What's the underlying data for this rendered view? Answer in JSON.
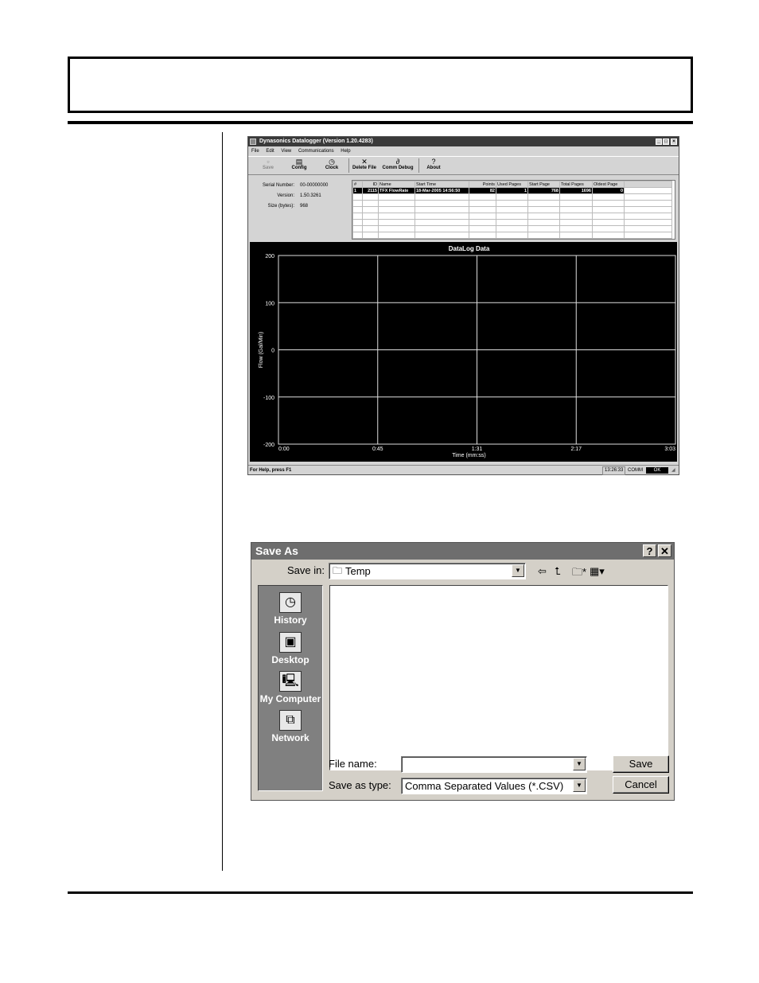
{
  "datalogger": {
    "title": "Dynasonics Datalogger (Version 1.20.4283)",
    "menu": [
      "File",
      "Edit",
      "View",
      "Communications",
      "Help"
    ],
    "toolbar": {
      "save": "Save",
      "config": "Config",
      "clock": "Clock",
      "delete_file": "Delete File",
      "comm_debug": "Comm Debug",
      "about": "About"
    },
    "info": {
      "serial_label": "Serial Number:",
      "serial_value": "00-00000000",
      "version_label": "Version:",
      "version_value": "1.50.3261",
      "size_label": "Size (bytes):",
      "size_value": "968"
    },
    "table": {
      "headers": [
        "#",
        "ID",
        "Name",
        "Start Time",
        "Points",
        "Used Pages",
        "Start Page",
        "Total Pages",
        "Oldest Page"
      ],
      "rows": [
        [
          "1",
          "2115",
          "TFX FlowRate",
          "18-Mar-2005 14:56:50",
          "82",
          "1",
          "768",
          "1696",
          "0"
        ]
      ]
    },
    "status": {
      "help": "For Help, press F1",
      "time": "13:26:33",
      "comm": "COMM",
      "ok": "OK"
    }
  },
  "chart_data": {
    "type": "line",
    "title": "DataLog Data",
    "xlabel": "Time (mm:ss)",
    "ylabel": "Flow (Gal/Min)",
    "x_ticks": [
      "0:00",
      "0:45",
      "1:31",
      "2:17",
      "3:03"
    ],
    "y_ticks": [
      200,
      100,
      0,
      -100,
      -200
    ],
    "ylim": [
      -200,
      200
    ],
    "grid": true,
    "series": []
  },
  "save_as": {
    "title": "Save As",
    "help_btn": "?",
    "close_btn": "✕",
    "save_in_label": "Save in:",
    "save_in_value": "Temp",
    "places": [
      "History",
      "Desktop",
      "My Computer",
      "Network"
    ],
    "file_name_label": "File name:",
    "file_name_value": "",
    "save_as_type_label": "Save as type:",
    "save_as_type_value": "Comma Separated Values (*.CSV)",
    "save_button": "Save",
    "cancel_button": "Cancel"
  }
}
